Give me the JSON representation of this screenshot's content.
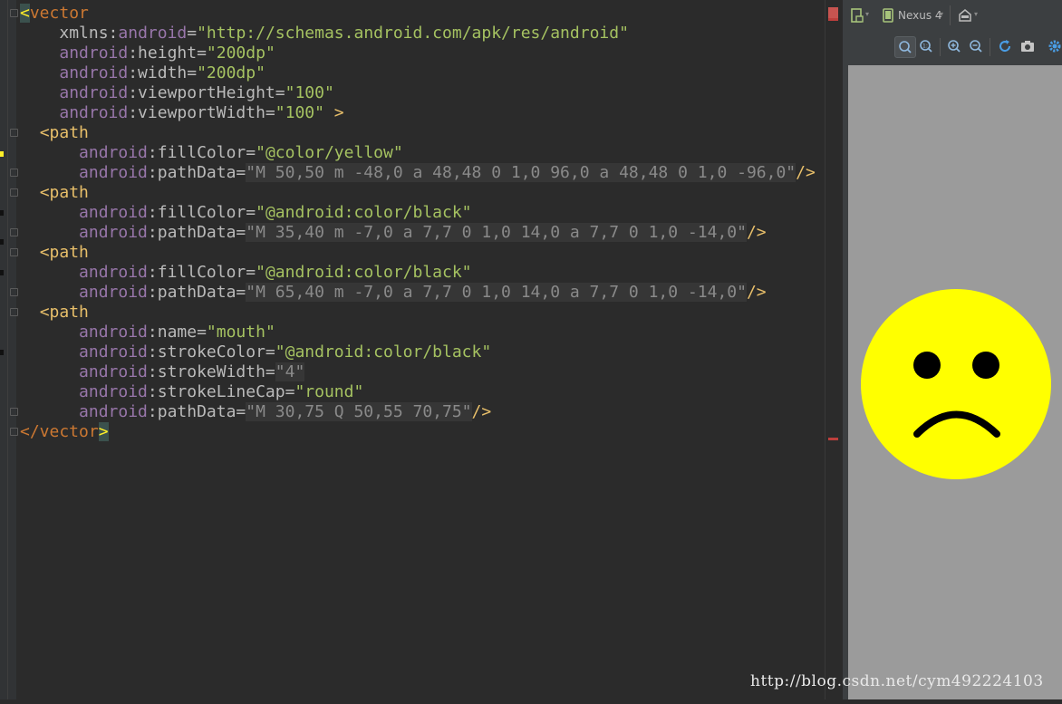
{
  "editor": {
    "lines": [
      {
        "parts": [
          {
            "c": "sel-tag",
            "t": "<"
          },
          {
            "c": "tag-red",
            "t": "vector"
          }
        ]
      },
      {
        "parts": [
          {
            "c": "",
            "t": "    "
          },
          {
            "c": "attr-name",
            "t": "xmlns:"
          },
          {
            "c": "attr-ns",
            "t": "android"
          },
          {
            "c": "attr-name",
            "t": "="
          },
          {
            "c": "val",
            "t": "\"http://schemas.android.com/apk/res/android\""
          }
        ]
      },
      {
        "parts": [
          {
            "c": "",
            "t": "    "
          },
          {
            "c": "attr-ns",
            "t": "android"
          },
          {
            "c": "attr-name",
            "t": ":height="
          },
          {
            "c": "val",
            "t": "\"200dp\""
          }
        ]
      },
      {
        "parts": [
          {
            "c": "",
            "t": "    "
          },
          {
            "c": "attr-ns",
            "t": "android"
          },
          {
            "c": "attr-name",
            "t": ":width="
          },
          {
            "c": "val",
            "t": "\"200dp\""
          }
        ]
      },
      {
        "parts": [
          {
            "c": "",
            "t": "    "
          },
          {
            "c": "attr-ns",
            "t": "android"
          },
          {
            "c": "attr-name",
            "t": ":viewportHeight="
          },
          {
            "c": "val",
            "t": "\"100\""
          }
        ]
      },
      {
        "parts": [
          {
            "c": "",
            "t": "    "
          },
          {
            "c": "attr-ns",
            "t": "android"
          },
          {
            "c": "attr-name",
            "t": ":viewportWidth="
          },
          {
            "c": "val",
            "t": "\"100\""
          },
          {
            "c": "tag",
            "t": " >"
          }
        ]
      },
      {
        "parts": [
          {
            "c": "",
            "t": "  "
          },
          {
            "c": "tag",
            "t": "<path"
          }
        ]
      },
      {
        "parts": [
          {
            "c": "",
            "t": "      "
          },
          {
            "c": "attr-ns",
            "t": "android"
          },
          {
            "c": "attr-name",
            "t": ":fillColor="
          },
          {
            "c": "val",
            "t": "\"@color/yellow\""
          }
        ]
      },
      {
        "parts": [
          {
            "c": "",
            "t": "      "
          },
          {
            "c": "attr-ns",
            "t": "android"
          },
          {
            "c": "attr-name",
            "t": ":pathData="
          },
          {
            "c": "path-val",
            "t": "\"M 50,50 m -48,0 a 48,48 0 1,0 96,0 a 48,48 0 1,0 -96,0\""
          },
          {
            "c": "tag",
            "t": "/>"
          }
        ]
      },
      {
        "parts": [
          {
            "c": "",
            "t": "  "
          },
          {
            "c": "tag",
            "t": "<path"
          }
        ]
      },
      {
        "parts": [
          {
            "c": "",
            "t": "      "
          },
          {
            "c": "attr-ns",
            "t": "android"
          },
          {
            "c": "attr-name",
            "t": ":fillColor="
          },
          {
            "c": "val",
            "t": "\"@android:color/black\""
          }
        ]
      },
      {
        "parts": [
          {
            "c": "",
            "t": "      "
          },
          {
            "c": "attr-ns",
            "t": "android"
          },
          {
            "c": "attr-name",
            "t": ":pathData="
          },
          {
            "c": "path-val",
            "t": "\"M 35,40 m -7,0 a 7,7 0 1,0 14,0 a 7,7 0 1,0 -14,0\""
          },
          {
            "c": "tag",
            "t": "/>"
          }
        ]
      },
      {
        "parts": [
          {
            "c": "",
            "t": "  "
          },
          {
            "c": "tag",
            "t": "<path"
          }
        ]
      },
      {
        "parts": [
          {
            "c": "",
            "t": "      "
          },
          {
            "c": "attr-ns",
            "t": "android"
          },
          {
            "c": "attr-name",
            "t": ":fillColor="
          },
          {
            "c": "val",
            "t": "\"@android:color/black\""
          }
        ]
      },
      {
        "parts": [
          {
            "c": "",
            "t": "      "
          },
          {
            "c": "attr-ns",
            "t": "android"
          },
          {
            "c": "attr-name",
            "t": ":pathData="
          },
          {
            "c": "path-val",
            "t": "\"M 65,40 m -7,0 a 7,7 0 1,0 14,0 a 7,7 0 1,0 -14,0\""
          },
          {
            "c": "tag",
            "t": "/>"
          }
        ]
      },
      {
        "parts": [
          {
            "c": "",
            "t": "  "
          },
          {
            "c": "tag",
            "t": "<path"
          }
        ]
      },
      {
        "parts": [
          {
            "c": "",
            "t": "      "
          },
          {
            "c": "attr-ns",
            "t": "android"
          },
          {
            "c": "attr-name",
            "t": ":name="
          },
          {
            "c": "val",
            "t": "\"mouth\""
          }
        ]
      },
      {
        "parts": [
          {
            "c": "",
            "t": "      "
          },
          {
            "c": "attr-ns",
            "t": "android"
          },
          {
            "c": "attr-name",
            "t": ":strokeColor="
          },
          {
            "c": "val",
            "t": "\"@android:color/black\""
          }
        ]
      },
      {
        "parts": [
          {
            "c": "",
            "t": "      "
          },
          {
            "c": "attr-ns",
            "t": "android"
          },
          {
            "c": "attr-name",
            "t": ":strokeWidth="
          },
          {
            "c": "path-val",
            "t": "\"4\""
          }
        ]
      },
      {
        "parts": [
          {
            "c": "",
            "t": "      "
          },
          {
            "c": "attr-ns",
            "t": "android"
          },
          {
            "c": "attr-name",
            "t": ":strokeLineCap="
          },
          {
            "c": "val",
            "t": "\"round\""
          }
        ]
      },
      {
        "parts": [
          {
            "c": "",
            "t": "      "
          },
          {
            "c": "attr-ns",
            "t": "android"
          },
          {
            "c": "attr-name",
            "t": ":pathData="
          },
          {
            "c": "path-val",
            "t": "\"M 30,75 Q 50,55 70,75\""
          },
          {
            "c": "tag",
            "t": "/>"
          }
        ]
      },
      {
        "parts": [
          {
            "c": "tag-red",
            "t": "</vector"
          },
          {
            "c": "sel-tag",
            "t": ">"
          }
        ]
      }
    ]
  },
  "toolbar": {
    "device_label": "Nexus 4",
    "icons": [
      "file-icon",
      "device-icon",
      "theme-icon",
      "zoom-fit-icon",
      "zoom-actual-icon",
      "zoom-in-icon",
      "zoom-out-icon",
      "refresh-icon",
      "screenshot-icon",
      "settings-icon"
    ]
  },
  "preview": {
    "face_color": "#ffff00",
    "feature_color": "#000000",
    "background_color": "#9b9b9b"
  },
  "watermark": "http://blog.csdn.net/cym492224103"
}
